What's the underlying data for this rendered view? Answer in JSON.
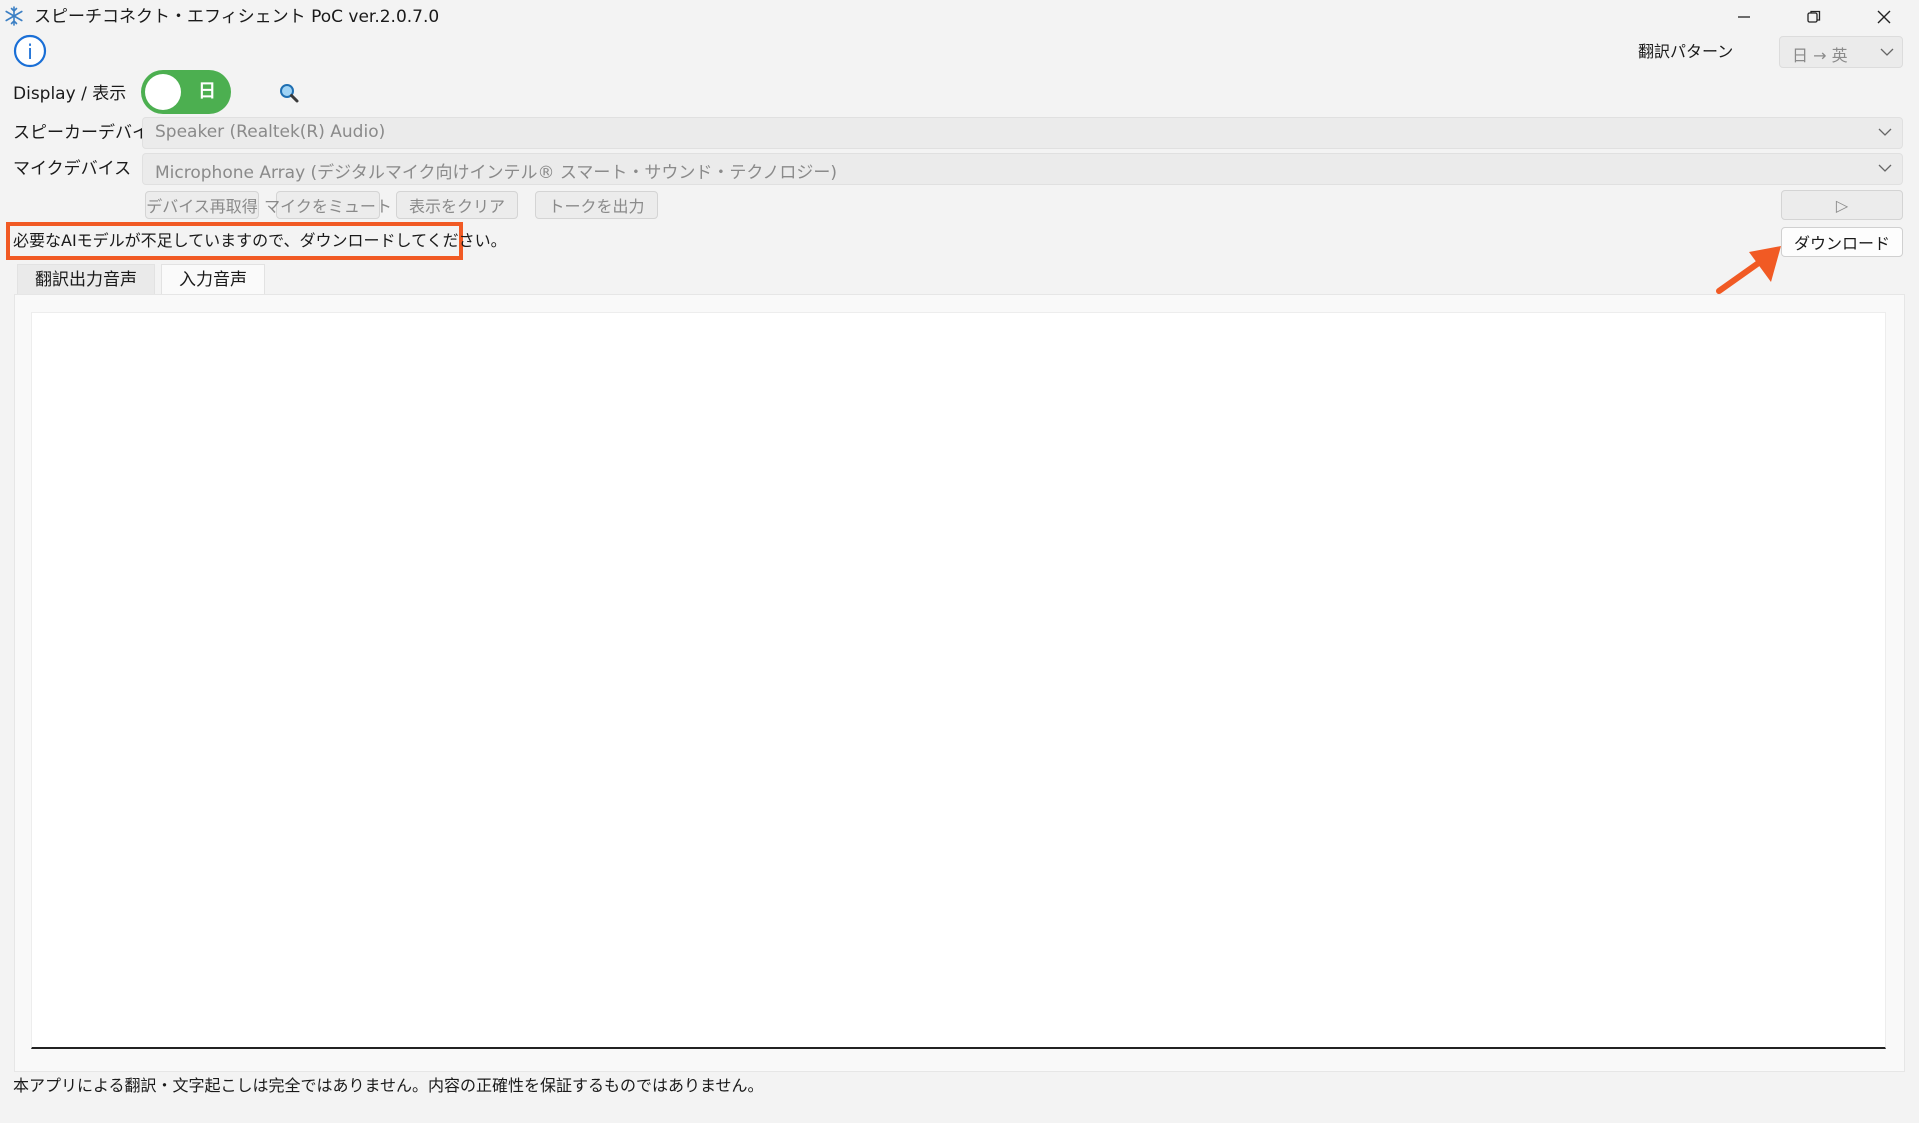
{
  "window": {
    "title": "スピーチコネクト・エフィシェント PoC ver.2.0.7.0",
    "icons": [
      "snowflake-app-icon",
      "minimize-icon",
      "restore-icon",
      "close-icon"
    ]
  },
  "header": {
    "info_icon": "i",
    "pattern_label": "翻訳パターン",
    "pattern_value": "日 → 英"
  },
  "display": {
    "label": "Display / 表示",
    "toggle_text": "日",
    "toggle_on": true,
    "toggle_color": "#4caf50"
  },
  "devices": {
    "speaker_label": "スピーカーデバイス",
    "speaker_value": "Speaker (Realtek(R) Audio)",
    "mic_label": "マイクデバイス",
    "mic_value": "Microphone Array (デジタルマイク向けインテル® スマート・サウンド・テクノロジー)"
  },
  "actions": {
    "reacquire": "デバイス再取得",
    "mute": "マイクをミュート",
    "clear": "表示をクリア",
    "output": "トークを出力",
    "play": "▷"
  },
  "message": {
    "text": "必要なAIモデルが不足していますので、ダウンロードしてください。",
    "highlight_color": "#f15a24"
  },
  "download_label": "ダウンロード",
  "tabs": [
    {
      "label": "翻訳出力音声"
    },
    {
      "label": "入力音声"
    }
  ],
  "footer": {
    "disclaimer": "本アプリによる翻訳・文字起こしは完全ではありません。内容の正確性を保証するものではありません。"
  }
}
